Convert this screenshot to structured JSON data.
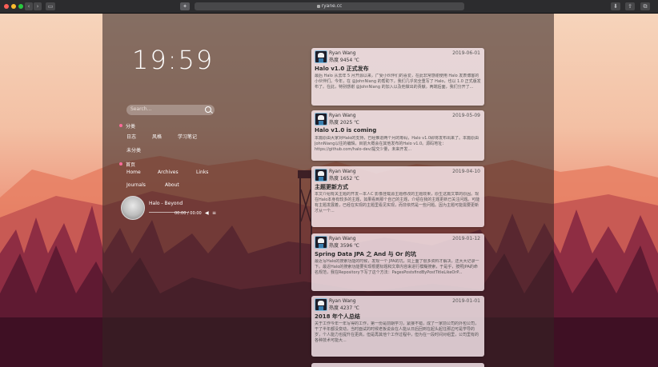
{
  "browser": {
    "url": "ryane.cc",
    "buttons": {
      "back": "‹",
      "forward": "›"
    }
  },
  "sidebar": {
    "clock": "19:59",
    "search_placeholder": "Search...",
    "categories_label": "分类",
    "categories": [
      "日志",
      "风格",
      "学习笔记"
    ],
    "uncategorized": "未分类",
    "home_label": "首页",
    "nav": [
      "Home",
      "Archives",
      "Links",
      "Journals",
      "About"
    ],
    "player": {
      "title": "Halo - Beyond",
      "time": "00:00 / 00:00"
    }
  },
  "posts": [
    {
      "author": "Ryan Wang",
      "heat": "热度 9454 ℃",
      "date": "2019-06-01",
      "title": "Halo v1.0 正式发布",
      "excerpt": "最后 Halo 从去年 5 月开源以来，广受小伙伴们的喜爱，在此非常感谢使用 Halo 发表博客的小伙伴们。今年，在 @JohnNiang 的帮助下，我们几乎完全重写了 Halo，也以 1.0 正式版发布了。在此，特别感谢 @JohnNiang 的加入以及他做出的贡献。两端后面，我们分开了..."
    },
    {
      "author": "Ryan Wang",
      "heat": "热度 2025 ℃",
      "date": "2019-05-09",
      "title": "Halo v1.0 is coming",
      "excerpt": "本篇原由大家对Halo的支持，已经推进两个月的筹码，Halo v1.0即将发布出来了。本篇原由JohnNiang以往的编辑，目前大概会在其他发布的Halo v1.0。源码地址：https://github.com/halo-dev/提交少量，未来开发..."
    },
    {
      "author": "Ryan Wang",
      "heat": "热度 1652 ℃",
      "date": "2019-04-10",
      "title": "主题更新方式",
      "excerpt": "本文介绍有关主题的开发—本人C 影像挂载源主题修改的主题效果，原生这篇文章的原因。现在Halo本身有较多的主题，如果看到那个自己的主题，介绍在我的主题更新已关注问题。可能有主题发展着，已经在实现的主题里看见实现，而非依然是一些问题。因为主题可能需要更新才从一个..."
    },
    {
      "author": "Ryan Wang",
      "heat": "热度 3596 ℃",
      "date": "2019-01-12",
      "title": "Spring Data JPA 之 And 与 Or 的坑",
      "excerpt": "最近写Halo的搜索功能的时候，发现一个 JPA的坑，同上面了很多资料才解决，还大大记录一下。最近Halo的搜索功能要实现根据标题和文章内容来进行模糊搜索，于是乎，按照JPA的命名规范，我在Repository下写了这个方法：PagesPostsfindByPostTitleLikeOrP..."
    },
    {
      "author": "Ryan Wang",
      "heat": "热度 4237 ℃",
      "date": "2019-01-01",
      "title": "2018 年个人总结",
      "excerpt": "关于工作今年一年写得的工作，第一份是前期学习，紧接不错，成了一家前公司的外包公司，干了半年都没变动，当时面试的时候老板说会在人能从日后回到在起头起往那边可是学导的岁，个人能力也提升在更高，但是再其他个工作过程中，但为在一段时间对组里，公司里有的各种技术可能大..."
    }
  ]
}
